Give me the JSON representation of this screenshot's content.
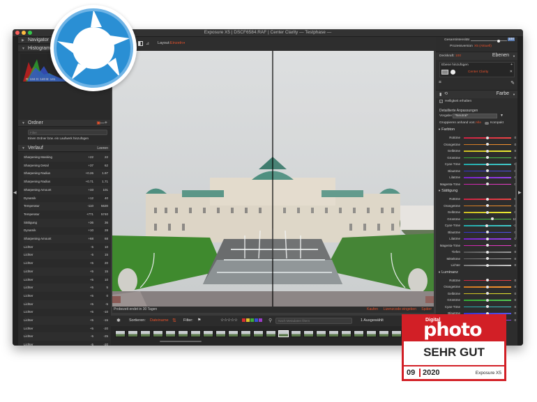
{
  "window": {
    "title": "Exposure X5 | DSCF6584.RAF | Center Clarity — Testphase —"
  },
  "left_panel": {
    "navigator_label": "Navigator",
    "histogram_label": "Histogramm",
    "histogram_readout": "R: 134   G: 140   B: 141",
    "folders_label": "Ordner",
    "search_placeholder": "Filter",
    "add_folder_hint": "Einen Ordner bzw. ein Laufwerk hinzufügen",
    "history_label": "Verlauf",
    "history_clear": "Leeren",
    "history": [
      {
        "name": "Sharpening Masking",
        "delta": "+22",
        "value": "22"
      },
      {
        "name": "Sharpening Detail",
        "delta": "+37",
        "value": "62"
      },
      {
        "name": "Sharpening Radius",
        "delta": "+0.26",
        "value": "1.97"
      },
      {
        "name": "Sharpening Radius",
        "delta": "+0.71",
        "value": "1.71"
      },
      {
        "name": "Sharpening Amount",
        "delta": "+33",
        "value": "101"
      },
      {
        "name": "Dynamik",
        "delta": "+12",
        "value": "40"
      },
      {
        "name": "Temperatur",
        "delta": "-110",
        "value": "5630"
      },
      {
        "name": "Temperatur",
        "delta": "+771",
        "value": "5740"
      },
      {
        "name": "Sättigung",
        "delta": "+36",
        "value": "36"
      },
      {
        "name": "Dynamik",
        "delta": "+10",
        "value": "28"
      },
      {
        "name": "Sharpening Amount",
        "delta": "+68",
        "value": "68"
      },
      {
        "name": "Lichter",
        "delta": "-5",
        "value": "10"
      },
      {
        "name": "Lichter",
        "delta": "-5",
        "value": "15"
      },
      {
        "name": "Lichter",
        "delta": "+5",
        "value": "20"
      },
      {
        "name": "Lichter",
        "delta": "+5",
        "value": "15"
      },
      {
        "name": "Lichter",
        "delta": "+5",
        "value": "10"
      },
      {
        "name": "Lichter",
        "delta": "+5",
        "value": "5"
      },
      {
        "name": "Lichter",
        "delta": "+5",
        "value": "0"
      },
      {
        "name": "Lichter",
        "delta": "+5",
        "value": "-5"
      },
      {
        "name": "Lichter",
        "delta": "+5",
        "value": "-10"
      },
      {
        "name": "Lichter",
        "delta": "+5",
        "value": "-15"
      },
      {
        "name": "Lichter",
        "delta": "+5",
        "value": "-20"
      },
      {
        "name": "Lichter",
        "delta": "-5",
        "value": "-25"
      },
      {
        "name": "Lichter",
        "delta": "-5",
        "value": "-20"
      },
      {
        "name": "Lichter",
        "delta": "-5",
        "value": "-15"
      },
      {
        "name": "Lichter",
        "delta": "-5",
        "value": "-10"
      }
    ]
  },
  "toolbar": {
    "layout_label": "Layout:",
    "layout_value": "Einzeln"
  },
  "status_bar": {
    "trial_text": "Probezeit endet in 30 Tagen",
    "buy": "Kaufen",
    "license": "Lizenzcode eingeben",
    "later": "Später"
  },
  "filter_bar": {
    "sort_label": "Sortieren:",
    "sort_value": "Dateiname",
    "filter_label": "Filter:",
    "search_placeholder": "Nach Metadaten filtern",
    "count": "1 Ausgewählt"
  },
  "right_panel": {
    "intensity_label": "Gesamtintensität",
    "intensity_value": "100",
    "process_label": "Prozessversion",
    "process_value": "X5 (Aktuell)",
    "opacity_label": "Deckkraft:",
    "opacity_value": "100",
    "layers_label": "Ebenen",
    "add_layer_label": "Ebene hinzufügen",
    "layer_name": "Center Clarity",
    "color_label": "Farbe",
    "keep_brightness": "Helligkeit erhalten",
    "detailed_label": "Detaillierte Anpassungen",
    "preset_label": "Vorgabe:",
    "preset_value": "*Neutral*",
    "group_label": "Gruppieren anhand von:",
    "group_value": "Alle",
    "compact_label": "Kompakt",
    "hue_label": "Farbton",
    "saturation_label": "Sättigung",
    "luminance_label": "Luminanz",
    "hue": [
      {
        "label": "Rottöne",
        "value": "0"
      },
      {
        "label": "Orangetöne",
        "value": "0"
      },
      {
        "label": "Gelbtöne",
        "value": "0"
      },
      {
        "label": "Grüntöne",
        "value": "0"
      },
      {
        "label": "Cyan-Töne",
        "value": "0"
      },
      {
        "label": "Blautöne",
        "value": "0"
      },
      {
        "label": "Lilatöne",
        "value": "0"
      },
      {
        "label": "Magenta-Töne",
        "value": "0"
      }
    ],
    "saturation": [
      {
        "label": "Rottöne",
        "value": "0"
      },
      {
        "label": "Orangetöne",
        "value": "0"
      },
      {
        "label": "Gelbtöne",
        "value": "0"
      },
      {
        "label": "Grüntöne",
        "value": "11"
      },
      {
        "label": "Cyan-Töne",
        "value": "-2"
      },
      {
        "label": "Blautöne",
        "value": "0"
      },
      {
        "label": "Lilatöne",
        "value": "0"
      },
      {
        "label": "Magenta-Töne",
        "value": "0"
      },
      {
        "label": "Tiefen",
        "value": "0"
      },
      {
        "label": "Mitteltöne",
        "value": "0"
      },
      {
        "label": "Lichter",
        "value": "0"
      }
    ],
    "luminance": [
      {
        "label": "Rottöne",
        "value": "0"
      },
      {
        "label": "Orangetöne",
        "value": "0"
      },
      {
        "label": "Gelbtöne",
        "value": "0"
      },
      {
        "label": "Grüntöne",
        "value": "0"
      },
      {
        "label": "Cyan-Töne",
        "value": "0"
      },
      {
        "label": "Blautöne",
        "value": "0"
      },
      {
        "label": "Lilatöne",
        "value": "0"
      }
    ]
  },
  "badge": {
    "top": "Digital",
    "brand": "photo",
    "rating": "SEHR GUT",
    "issue_month": "09",
    "issue_year": "2020",
    "product": "Exposure X5"
  },
  "colors": {
    "accent": "#e8512b",
    "badge_red": "#d21f26",
    "logo_blue": "#2a8fd4"
  }
}
